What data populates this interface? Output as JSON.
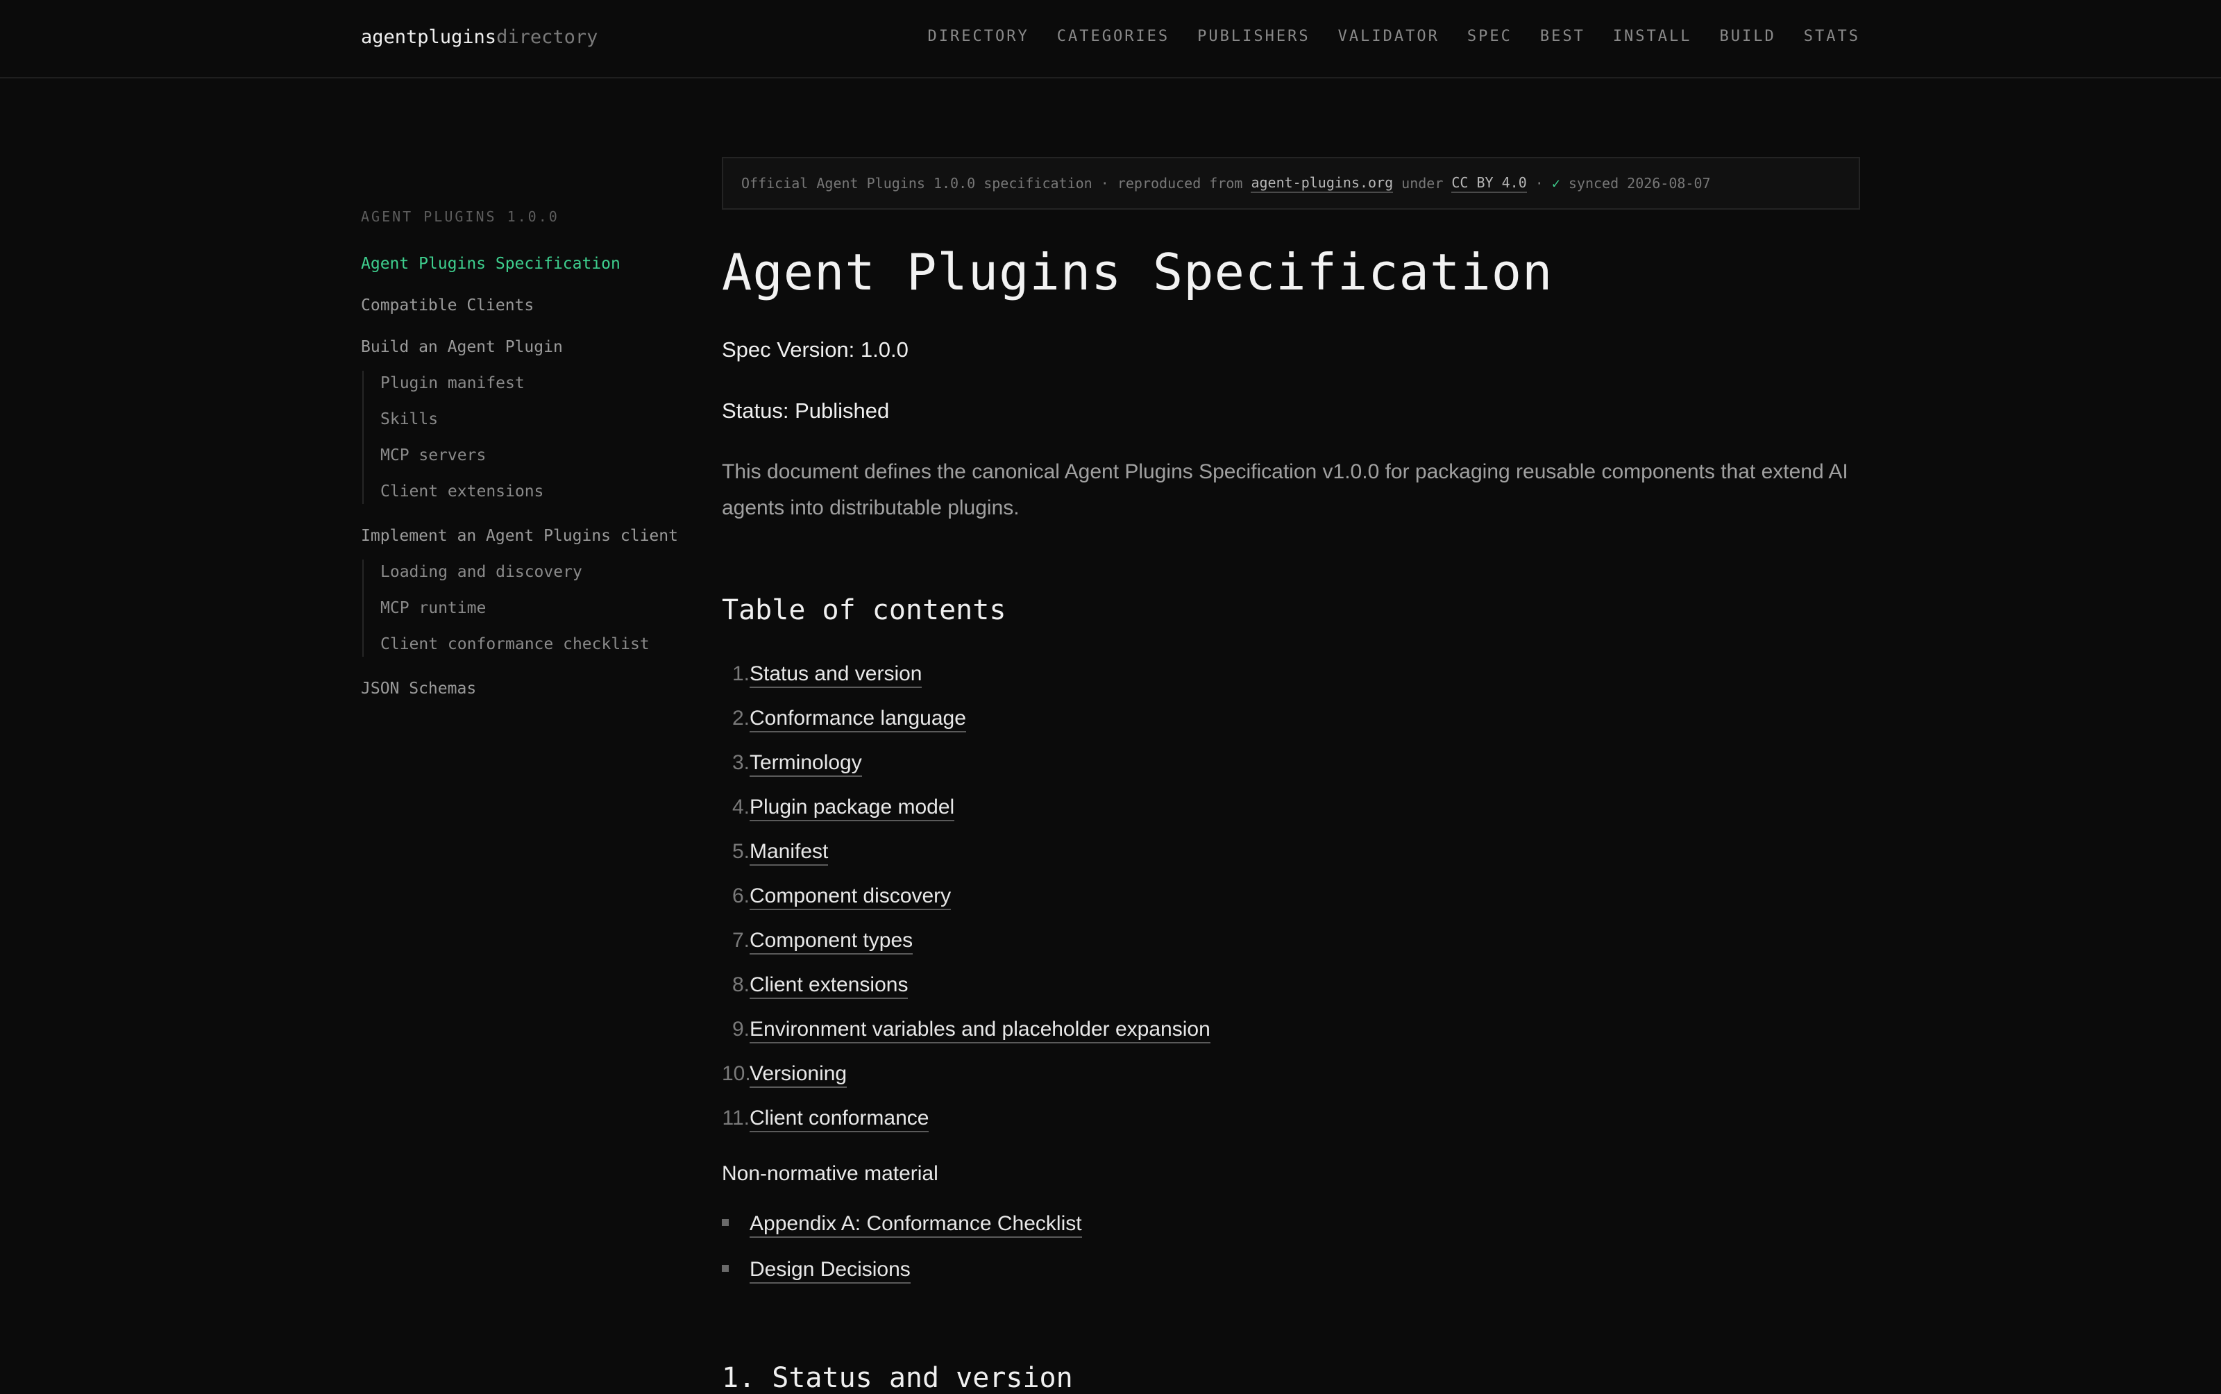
{
  "header": {
    "brand_primary": "agentplugins",
    "brand_secondary": "directory",
    "nav": [
      "DIRECTORY",
      "CATEGORIES",
      "PUBLISHERS",
      "VALIDATOR",
      "SPEC",
      "BEST",
      "INSTALL",
      "BUILD",
      "STATS"
    ]
  },
  "sidebar": {
    "heading": "AGENT PLUGINS 1.0.0",
    "items": {
      "spec": "Agent Plugins Specification",
      "clients": "Compatible Clients",
      "build": "Build an Agent Plugin",
      "build_sub": [
        "Plugin manifest",
        "Skills",
        "MCP servers",
        "Client extensions"
      ],
      "implement": "Implement an Agent Plugins client",
      "implement_sub": [
        "Loading and discovery",
        "MCP runtime",
        "Client conformance checklist"
      ],
      "schemas": "JSON Schemas"
    }
  },
  "notice": {
    "prefix": "Official Agent Plugins 1.0.0 specification · reproduced from",
    "source_link": "agent-plugins.org",
    "under": "under",
    "license_link": "CC BY 4.0",
    "dot": "·",
    "check": "✓",
    "synced": "synced 2026-08-07"
  },
  "main": {
    "title": "Agent Plugins Specification",
    "spec_version": "Spec Version: 1.0.0",
    "status": "Status: Published",
    "intro": "This document defines the canonical Agent Plugins Specification v1.0.0 for packaging reusable components that extend AI agents into distributable plugins.",
    "toc_heading": "Table of contents",
    "toc": [
      {
        "num": "1.",
        "label": "Status and version"
      },
      {
        "num": "2.",
        "label": "Conformance language"
      },
      {
        "num": "3.",
        "label": "Terminology"
      },
      {
        "num": "4.",
        "label": "Plugin package model"
      },
      {
        "num": "5.",
        "label": "Manifest"
      },
      {
        "num": "6.",
        "label": "Component discovery"
      },
      {
        "num": "7.",
        "label": "Component types"
      },
      {
        "num": "8.",
        "label": "Client extensions"
      },
      {
        "num": "9.",
        "label": "Environment variables and placeholder expansion"
      },
      {
        "num": "10.",
        "label": "Versioning"
      },
      {
        "num": "11.",
        "label": "Client conformance"
      }
    ],
    "nonnormative_heading": "Non-normative material",
    "appendix": [
      "Appendix A: Conformance Checklist",
      "Design Decisions"
    ],
    "next_section": "1. Status and version"
  },
  "colors": {
    "background": "#0b0b0b",
    "accent": "#3ecf8e",
    "text": "#e8e8e8",
    "muted": "#8a8a8a"
  }
}
